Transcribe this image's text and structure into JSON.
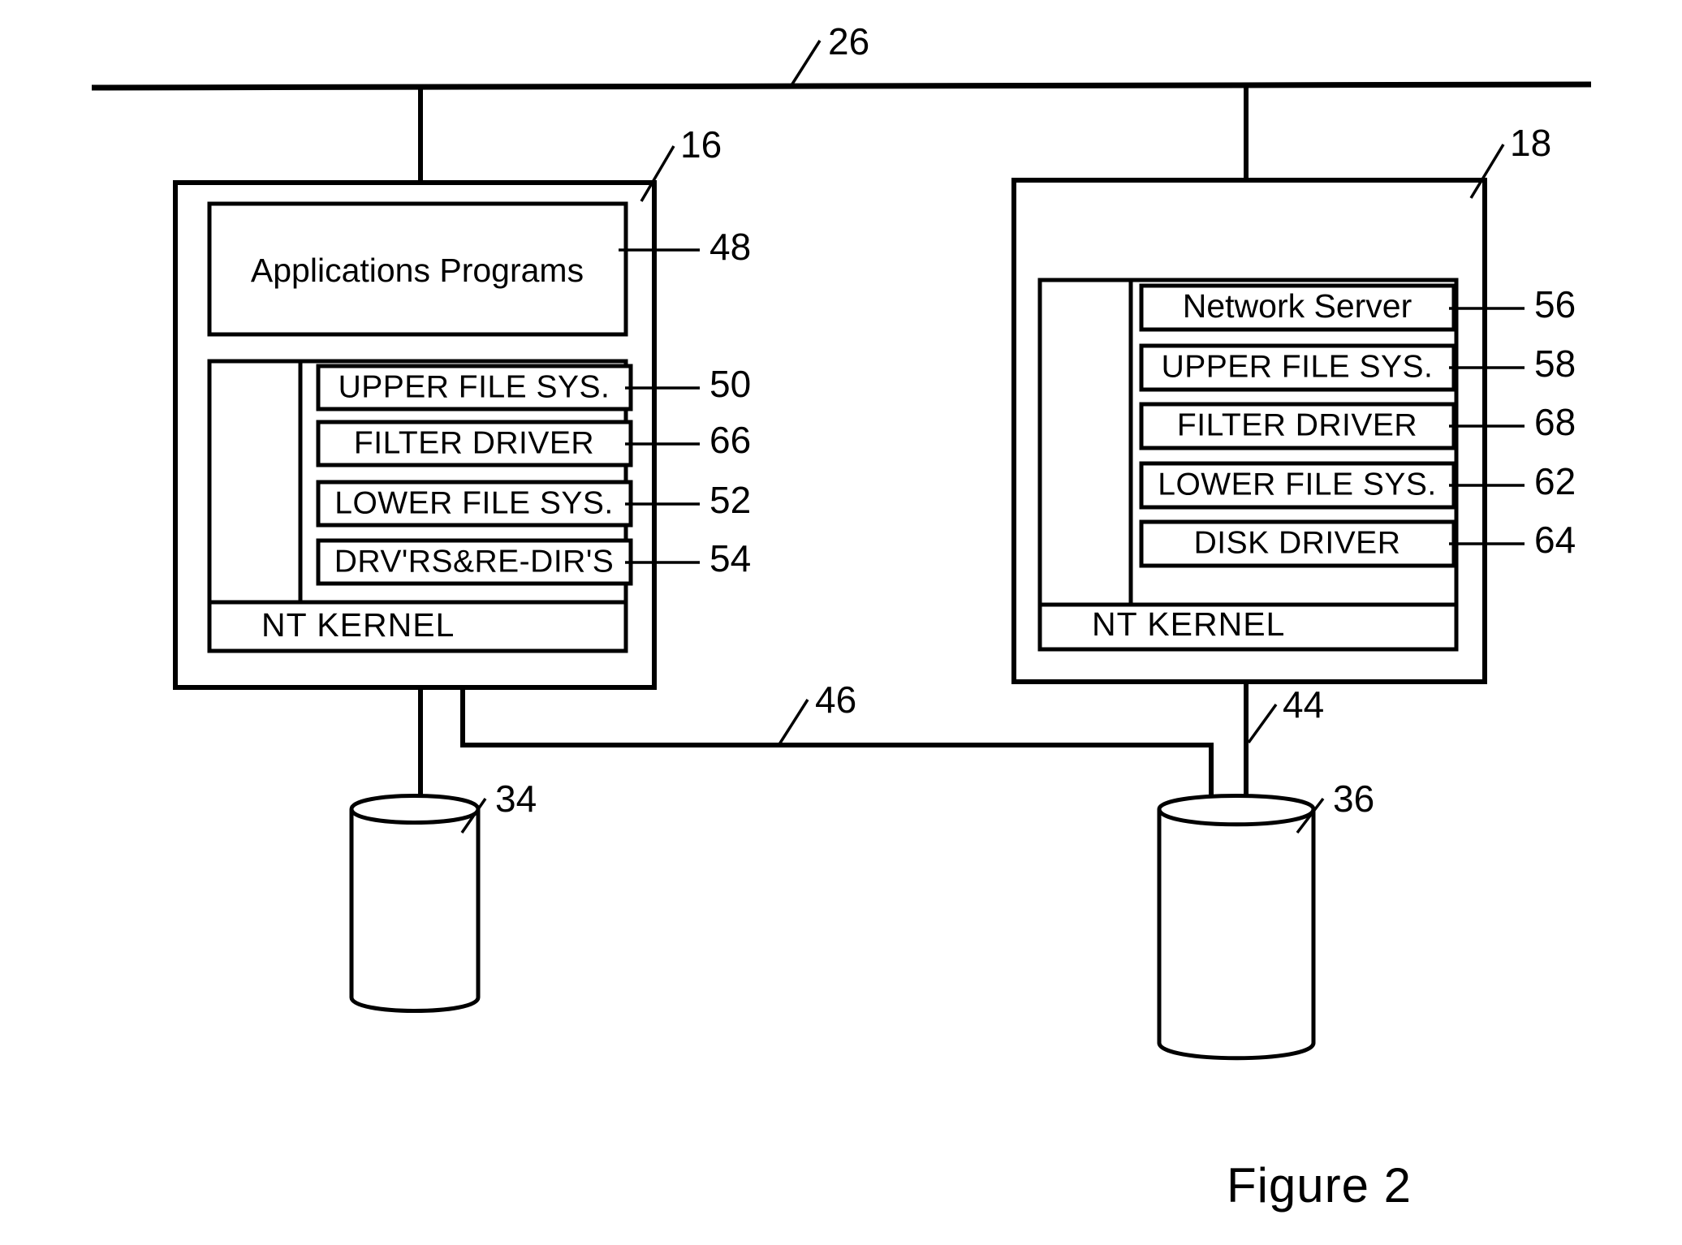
{
  "figure": {
    "caption": "Figure 2",
    "network_bus_ref": "26"
  },
  "left_node": {
    "ref": "16",
    "storage_ref": "34",
    "kernel_label": "NT  KERNEL",
    "top_box": {
      "label": "Applications Programs",
      "ref": "48"
    },
    "stack": [
      {
        "label": "UPPER FILE SYS.",
        "ref": "50"
      },
      {
        "label": "FILTER DRIVER",
        "ref": "66"
      },
      {
        "label": "LOWER FILE SYS.",
        "ref": "52"
      },
      {
        "label": "DRV'RS&RE-DIR'S",
        "ref": "54"
      }
    ]
  },
  "right_node": {
    "ref": "18",
    "storage_ref": "36",
    "storage_link_ref": "44",
    "kernel_label": "NT  KERNEL",
    "stack": [
      {
        "label": "Network Server",
        "ref": "56"
      },
      {
        "label": "UPPER FILE SYS.",
        "ref": "58"
      },
      {
        "label": "FILTER DRIVER",
        "ref": "68"
      },
      {
        "label": "LOWER FILE SYS.",
        "ref": "62"
      },
      {
        "label": "DISK DRIVER",
        "ref": "64"
      }
    ]
  },
  "cross_link": {
    "ref": "46"
  },
  "colors": {
    "ink": "#000000",
    "paper": "#ffffff"
  }
}
